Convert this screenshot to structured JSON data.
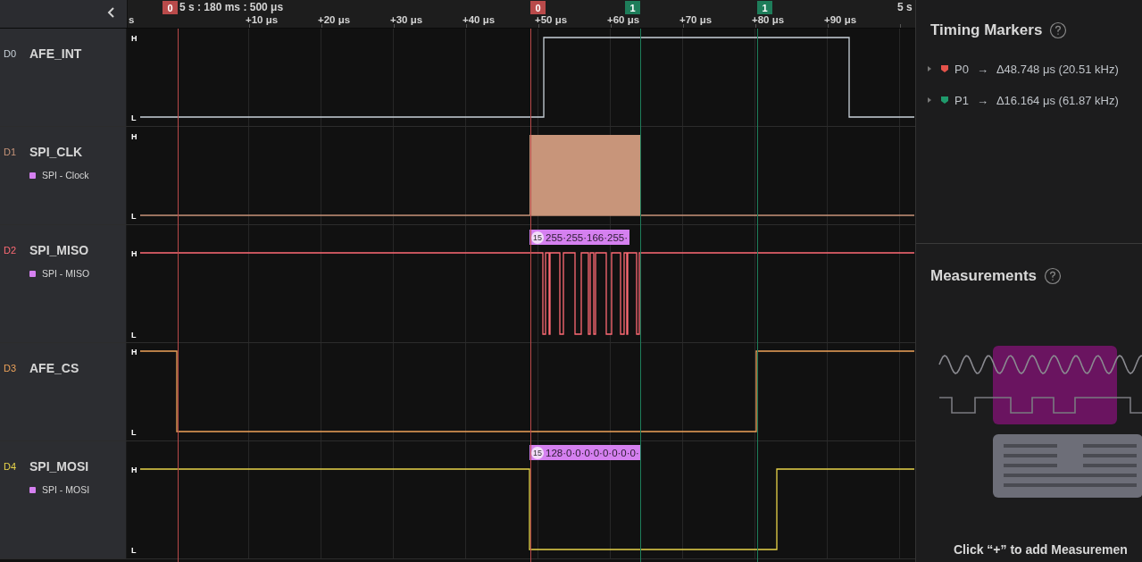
{
  "ruler": {
    "timestamp": "5 s : 180 ms : 500 μs",
    "end_label": "5 s",
    "ticks": [
      "s",
      "+10 μs",
      "+20 μs",
      "+30 μs",
      "+40 μs",
      "+50 μs",
      "+60 μs",
      "+70 μs",
      "+80 μs",
      "+90 μs"
    ]
  },
  "markers": [
    {
      "label": "0",
      "color": "#b94a4a"
    },
    {
      "label": "0",
      "color": "#b94a4a"
    },
    {
      "label": "1",
      "color": "#1e7d5a"
    },
    {
      "label": "1",
      "color": "#1e7d5a"
    }
  ],
  "channels": [
    {
      "code": "D0",
      "name": "AFE_INT",
      "color": "#c9d1d9",
      "high_label": "H",
      "low_label": "L"
    },
    {
      "code": "D1",
      "name": "SPI_CLK",
      "color": "#c8957a",
      "high_label": "H",
      "low_label": "L",
      "analyzer": "SPI - Clock"
    },
    {
      "code": "D2",
      "name": "SPI_MISO",
      "color": "#ff6b75",
      "high_label": "H",
      "low_label": "L",
      "analyzer": "SPI - MISO",
      "frame": {
        "count": "15",
        "text": "255·255·166·255·"
      }
    },
    {
      "code": "D3",
      "name": "AFE_CS",
      "color": "#eea35a",
      "high_label": "H",
      "low_label": "L"
    },
    {
      "code": "D4",
      "name": "SPI_MOSI",
      "color": "#e8d44a",
      "high_label": "H",
      "low_label": "L",
      "analyzer": "SPI - MOSI",
      "frame": {
        "count": "15",
        "text": "128·0·0·0·0·0·0·0·0·"
      }
    }
  ],
  "timing_markers": {
    "title": "Timing Markers",
    "items": [
      {
        "name": "P0",
        "arrow": "→",
        "delta": "Δ48.748 μs (20.51 kHz)",
        "color": "#e5534b",
        "expanded": false
      },
      {
        "name": "P1",
        "arrow": "→",
        "delta": "Δ16.164 μs (61.87 kHz)",
        "color": "#1f9a6c",
        "expanded": false
      }
    ]
  },
  "measurements": {
    "title": "Measurements",
    "hint": "Click “+” to add Measuremen"
  }
}
